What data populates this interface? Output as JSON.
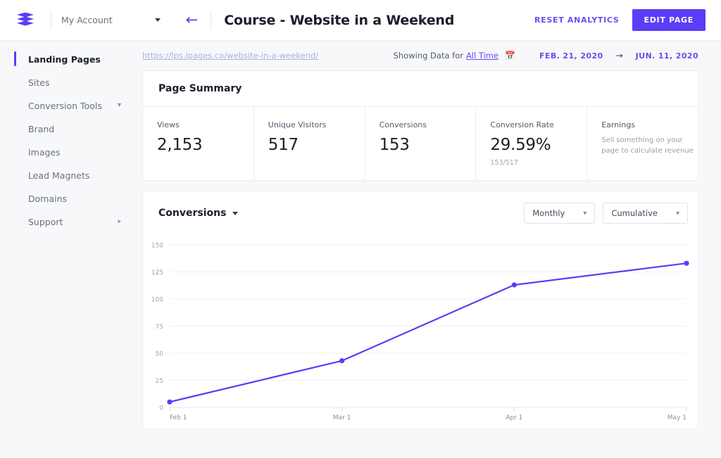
{
  "header": {
    "logo_icon": "layers-icon",
    "account_label": "My Account",
    "account_caret_icon": "caret-down-icon",
    "back_icon": "arrow-left-icon",
    "page_title": "Course - Website in a Weekend",
    "reset_analytics_label": "RESET ANALYTICS",
    "edit_page_label": "EDIT PAGE",
    "accent_color": "#5b3df5"
  },
  "sidebar": {
    "items": [
      {
        "label": "Landing Pages",
        "active": true,
        "chevron": ""
      },
      {
        "label": "Sites",
        "active": false,
        "chevron": ""
      },
      {
        "label": "Conversion Tools",
        "active": false,
        "chevron": "down"
      },
      {
        "label": "Brand",
        "active": false,
        "chevron": ""
      },
      {
        "label": "Images",
        "active": false,
        "chevron": ""
      },
      {
        "label": "Lead Magnets",
        "active": false,
        "chevron": ""
      },
      {
        "label": "Domains",
        "active": false,
        "chevron": ""
      },
      {
        "label": "Support",
        "active": false,
        "chevron": "right"
      }
    ]
  },
  "meta": {
    "page_url": "https://lps.lpages.co/website-in-a-weekend/",
    "showing_label": "Showing Data for",
    "range_link": "All Time",
    "calendar_icon": "calendar-icon",
    "date_from": "FEB. 21, 2020",
    "date_arrow_icon": "arrow-right-icon",
    "date_to": "JUN. 11, 2020"
  },
  "page_summary": {
    "title": "Page Summary",
    "metrics": [
      {
        "label": "Views",
        "value": "2,153",
        "sub": "",
        "note": ""
      },
      {
        "label": "Unique Visitors",
        "value": "517",
        "sub": "",
        "note": ""
      },
      {
        "label": "Conversions",
        "value": "153",
        "sub": "",
        "note": ""
      },
      {
        "label": "Conversion Rate",
        "value": "29.59%",
        "sub": "153/517",
        "note": ""
      },
      {
        "label": "Earnings",
        "value": "",
        "sub": "",
        "note": "Sell something on your page to calculate revenue"
      }
    ]
  },
  "conversions_card": {
    "title": "Conversions",
    "title_caret_icon": "caret-down-icon",
    "interval_select": {
      "value": "Monthly",
      "chevron_icon": "chevron-down-icon"
    },
    "mode_select": {
      "value": "Cumulative",
      "chevron_icon": "chevron-down-icon"
    }
  },
  "chart_data": {
    "type": "line",
    "title": "Conversions",
    "xlabel": "",
    "ylabel": "",
    "x": [
      "Feb 1",
      "Mar 1",
      "Apr 1",
      "May 1"
    ],
    "categories": [
      "Feb 1",
      "Mar 1",
      "Apr 1",
      "May 1"
    ],
    "series": [
      {
        "name": "Conversions (cumulative)",
        "values": [
          5,
          43,
          113,
          133
        ],
        "color": "#5b3df5"
      }
    ],
    "yticks": [
      0,
      25,
      50,
      75,
      100,
      125,
      150
    ],
    "ylim": [
      0,
      150
    ],
    "grid": true,
    "legend": "none",
    "markers": true
  }
}
